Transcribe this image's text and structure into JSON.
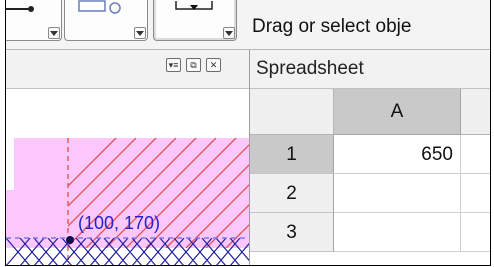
{
  "toolbar": {
    "help_text": "Drag or select obje",
    "tools": [
      {
        "icon": "shape-tool-icon",
        "state": "normal"
      },
      {
        "icon": "polygon-tool-icon",
        "state": "normal"
      },
      {
        "icon": "point-tool-icon",
        "state": "active"
      }
    ]
  },
  "graphics_view": {
    "controls": [
      "style-bar-toggle-icon",
      "maximize-view-icon",
      "close-view-icon"
    ],
    "point_label": "(100, 170)",
    "colors": {
      "fill": "#fcc7fc",
      "hatch": "#e05050",
      "dashed_boundary": "#e06060",
      "point": "#101050",
      "label": "#2222cc",
      "lower_hatch": "#7a7aee"
    }
  },
  "spreadsheet": {
    "title": "Spreadsheet",
    "columns": [
      "A"
    ],
    "rows": [
      {
        "number": "1",
        "A": "650",
        "selected": true
      },
      {
        "number": "2",
        "A": "",
        "selected": false
      },
      {
        "number": "3",
        "A": "",
        "selected": false
      }
    ]
  }
}
